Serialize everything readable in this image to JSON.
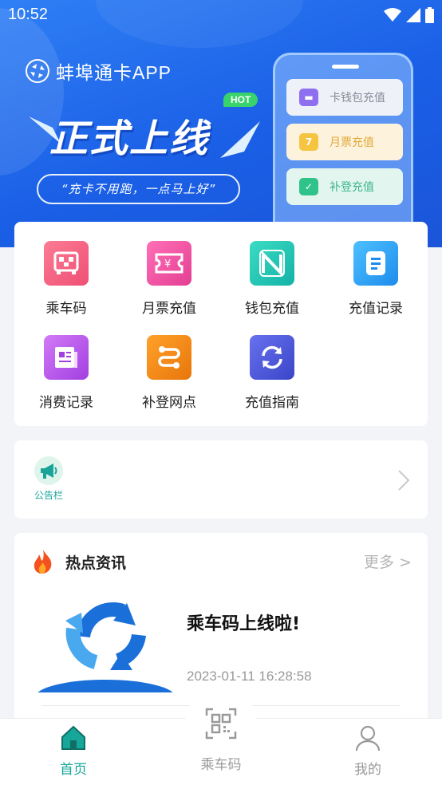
{
  "status_bar": {
    "time": "10:52"
  },
  "hero": {
    "app_title": "蚌埠通卡APP",
    "hot_badge": "HOT",
    "slogan": "正式上线",
    "subtitle": "“充卡不用跑，一点马上好”",
    "phone_options": [
      {
        "label": "卡钱包充值",
        "icon": "wallet-icon",
        "color": "#8d6ff0",
        "bg": "#eef1f7",
        "text_color": "#8a8a9a"
      },
      {
        "label": "月票充值",
        "icon": "calendar-icon",
        "color": "#f5c542",
        "bg": "#fdf3dc",
        "text_color": "#e0a93a"
      },
      {
        "label": "补登充值",
        "icon": "check-icon",
        "color": "#2fc38a",
        "bg": "#e2f6ef",
        "text_color": "#3cb58a"
      }
    ]
  },
  "services": [
    {
      "label": "乘车码",
      "icon": "bus-code-icon",
      "color": "#f2607f"
    },
    {
      "label": "月票充值",
      "icon": "ticket-icon",
      "color": "#ef4fa0"
    },
    {
      "label": "钱包充值",
      "icon": "nfc-icon",
      "color": "#22c4b3"
    },
    {
      "label": "充值记录",
      "icon": "record-icon",
      "color": "#2e9ef0"
    },
    {
      "label": "消费记录",
      "icon": "receipt-icon",
      "color": "#b44fe0"
    },
    {
      "label": "补登网点",
      "icon": "route-icon",
      "color": "#f0860a"
    },
    {
      "label": "充值指南",
      "icon": "refresh-guide-icon",
      "color": "#4f58d8"
    }
  ],
  "notice": {
    "label": "公告栏"
  },
  "news": {
    "title": "热点资讯",
    "more": "更多 >",
    "articles": [
      {
        "title": "乘车码上线啦!",
        "date": "2023-01-11 16:28:58"
      }
    ]
  },
  "bottom_nav": [
    {
      "label": "首页",
      "active": true,
      "color": "#16a79a"
    },
    {
      "label": "乘车码",
      "active": false,
      "color": "#9a9a9a"
    },
    {
      "label": "我的",
      "active": false,
      "color": "#9a9a9a"
    }
  ]
}
